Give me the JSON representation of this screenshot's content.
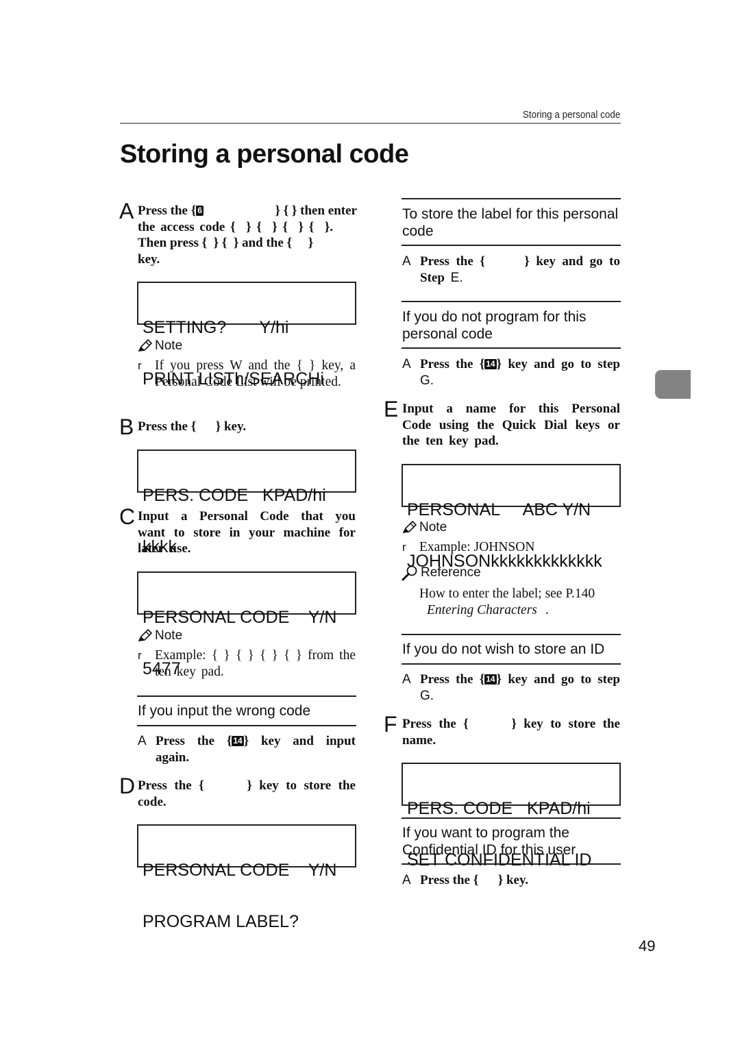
{
  "running_head": "Storing a personal code",
  "page_title": "Storing a personal code",
  "page_number": "49",
  "icons": {
    "note": "pencil-icon",
    "reference": "magnifier-icon",
    "key": "key-glyph"
  },
  "left_column": {
    "step_a": {
      "letter": "A",
      "line1_pre": "Press the {",
      "key_glyph": "6",
      "line1_post": "} {  } then enter",
      "line2": "the access code {  } {  } {  } {  }.",
      "line3": "Then press {  } {  } and the {     }",
      "line4": "key."
    },
    "lcd_1": {
      "line1": "SETTING?       Y/hi",
      "line2": "PRINT LISTh/SEARCHi"
    },
    "note_1": {
      "title": "Note",
      "bullet": "r",
      "text": "If you press W and the {       } key, a Personal Code List will be printed."
    },
    "step_b": {
      "letter": "B",
      "text": "Press the {      } key."
    },
    "lcd_2": {
      "line1": "PERS. CODE   KPAD/hi",
      "line2": "kkkk"
    },
    "step_c": {
      "letter": "C",
      "text": "Input a Personal Code that you want to store in your machine for later use."
    },
    "lcd_3": {
      "line1": "PERSONAL CODE    Y/N",
      "line2": "5477"
    },
    "note_2": {
      "title": "Note",
      "bullet": "r",
      "text": "Example: {  } {  } {  } {  } from the ten key pad."
    },
    "sub_wrong_code": {
      "heading": "If you input the wrong code",
      "step_letter": "A",
      "step_pre": "Press the {",
      "key_glyph": "14",
      "step_post": "} key and input again."
    },
    "step_d": {
      "letter": "D",
      "text": "Press the {      } key to store the code."
    },
    "lcd_4": {
      "line1": "PERSONAL CODE    Y/N",
      "line2": "PROGRAM LABEL?"
    }
  },
  "right_column": {
    "sub_store_label": {
      "heading": "To store the label for this personal code",
      "step_letter": "A",
      "step_text": "Press the {      } key and go to Step ",
      "step_ref": "E."
    },
    "sub_no_program": {
      "heading": "If you do not program for this personal code",
      "step_letter": "A",
      "step_pre": "Press the {",
      "key_glyph": "14",
      "step_post": "} key and go to step ",
      "step_ref": "G."
    },
    "step_e": {
      "letter": "E",
      "text": "Input a name for this Personal Code using the Quick Dial keys or the ten key pad."
    },
    "lcd_5": {
      "line1": "PERSONAL     ABC Y/N",
      "line2": "JOHNSONkkkkkkkkkkkkk"
    },
    "note_3": {
      "title": "Note",
      "bullet": "r",
      "text": "Example: JOHNSON"
    },
    "reference": {
      "title": "Reference",
      "text": "How to enter the label; see P.140",
      "link": "Entering Characters",
      "trail": "."
    },
    "sub_no_id": {
      "heading": "If you do not wish to store an ID",
      "step_letter": "A",
      "step_pre": "Press the {",
      "key_glyph": "14",
      "step_post": "} key and go to step ",
      "step_ref": "G."
    },
    "step_f": {
      "letter": "F",
      "text": "Press the {      } key to store the name."
    },
    "lcd_6": {
      "line1": "PERS. CODE   KPAD/hi",
      "line2": "SET CONFIDENTIAL ID"
    },
    "sub_program_id": {
      "heading": "If you want to program the Confidential ID for this user",
      "step_letter": "A",
      "step_text": "Press the {      } key."
    }
  }
}
